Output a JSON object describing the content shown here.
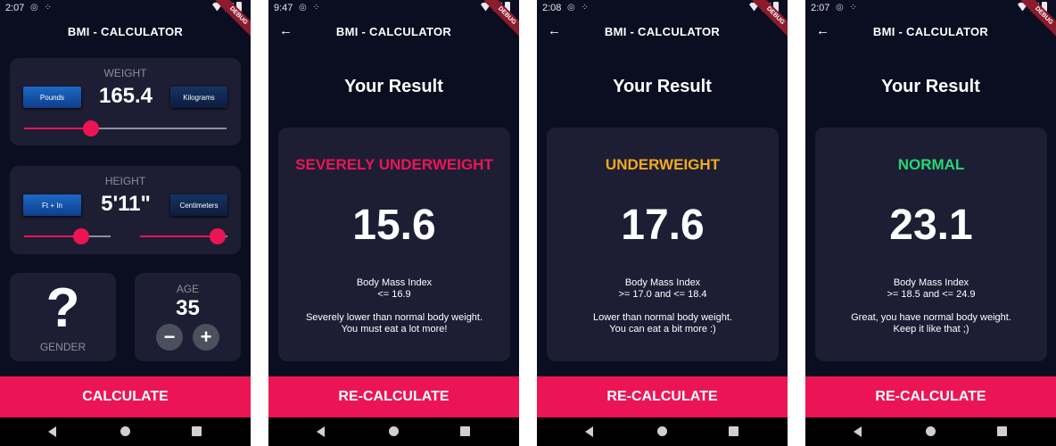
{
  "colors": {
    "background": "#0b0d20",
    "card": "#1d1e33",
    "accent": "#eb1555",
    "severely_underweight": "#eb1555",
    "underweight": "#f2a91f",
    "normal": "#24d876"
  },
  "screen1": {
    "time": "2:07",
    "title": "BMI - CALCULATOR",
    "debug": "DEBUG",
    "weight": {
      "label": "WEIGHT",
      "value": "165.4",
      "unit_left": "Pounds",
      "unit_right": "Kilograms",
      "slider_level": 0.33
    },
    "height": {
      "label": "HEIGHT",
      "value": "5'11\"",
      "unit_left": "Ft + In",
      "unit_right": "Centimeters",
      "slider_left_level": 0.65,
      "slider_right_level": 0.9
    },
    "gender": {
      "icon": "?",
      "label": "GENDER"
    },
    "age": {
      "label": "AGE",
      "value": "35",
      "minus": "−",
      "plus": "+"
    },
    "button": "CALCULATE"
  },
  "results": [
    {
      "time": "9:47",
      "title": "BMI - CALCULATOR",
      "debug": "DEBUG",
      "heading": "Your Result",
      "status": "SEVERELY UNDERWEIGHT",
      "status_color": "#eb1555",
      "bmi": "15.6",
      "index_label": "Body Mass Index",
      "range": "<= 16.9",
      "message_1": "Severely lower than normal body weight.",
      "message_2": "You must eat a lot more!",
      "button": "RE-CALCULATE"
    },
    {
      "time": "2:08",
      "title": "BMI - CALCULATOR",
      "debug": "DEBUG",
      "heading": "Your Result",
      "status": "UNDERWEIGHT",
      "status_color": "#f2a91f",
      "bmi": "17.6",
      "index_label": "Body Mass Index",
      "range": ">= 17.0 and <= 18.4",
      "message_1": "Lower than normal body weight.",
      "message_2": "You can eat a bit more :)",
      "button": "RE-CALCULATE"
    },
    {
      "time": "2:07",
      "title": "BMI - CALCULATOR",
      "debug": "DEBUG",
      "heading": "Your Result",
      "status": "NORMAL",
      "status_color": "#24d876",
      "bmi": "23.1",
      "index_label": "Body Mass Index",
      "range": ">= 18.5 and <= 24.9",
      "message_1": "Great, you have normal body weight.",
      "message_2": "Keep it like that ;)",
      "button": "RE-CALCULATE"
    }
  ]
}
